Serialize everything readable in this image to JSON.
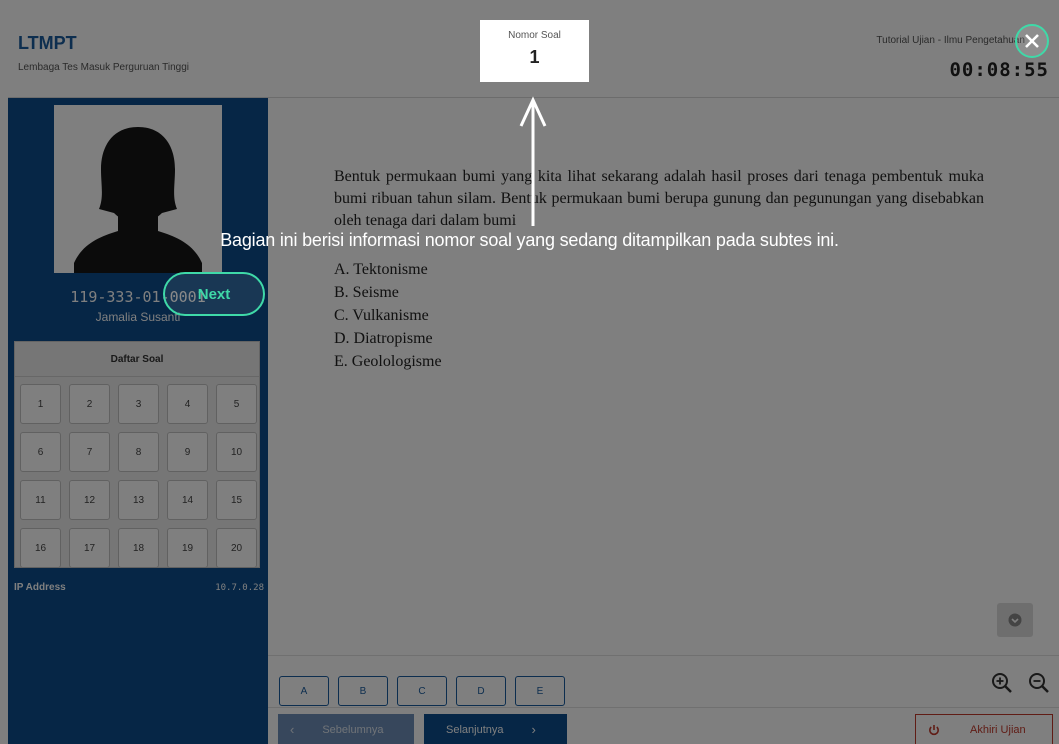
{
  "header": {
    "brand_title": "LTMPT",
    "brand_subtitle": "Lembaga Tes Masuk Perguruan Tinggi",
    "right_title": "Tutorial Ujian - Ilmu Pengetahuan",
    "timer": "00:08:55"
  },
  "question_indicator": {
    "label": "Nomor Soal",
    "value": "1"
  },
  "sidebar": {
    "user_id": "119-333-01-0001",
    "user_name": "Jamalia Susanti",
    "daftar_title": "Daftar Soal",
    "numbers": [
      "1",
      "2",
      "3",
      "4",
      "5",
      "6",
      "7",
      "8",
      "9",
      "10",
      "11",
      "12",
      "13",
      "14",
      "15",
      "16",
      "17",
      "18",
      "19",
      "20"
    ],
    "ip_label": "IP Address",
    "ip_value": "10.7.0.28"
  },
  "question": {
    "text": "Bentuk permukaan bumi yang kita lihat sekarang adalah hasil proses dari tenaga pembentuk muka bumi ribuan tahun silam. Bentuk permukaan bumi berupa gunung dan pegunungan yang disebabkan oleh tenaga dari dalam bumi",
    "options": [
      "A. Tektonisme",
      "B. Seisme",
      "C. Vulkanisme",
      "D. Diatropisme",
      "E. Geolologisme"
    ]
  },
  "answer_buttons": [
    "A",
    "B",
    "C",
    "D",
    "E"
  ],
  "nav": {
    "prev_label": "Sebelumnya",
    "next_label": "Selanjutnya",
    "end_label": "Akhiri Ujian"
  },
  "tour": {
    "message": "Bagian ini berisi informasi nomor soal yang sedang ditampilkan pada subtes ini.",
    "next_label": "Next",
    "highlight_color": "#3fd9a8"
  },
  "colors": {
    "brand_blue": "#0d4d8c",
    "danger_red": "#c0392b"
  }
}
